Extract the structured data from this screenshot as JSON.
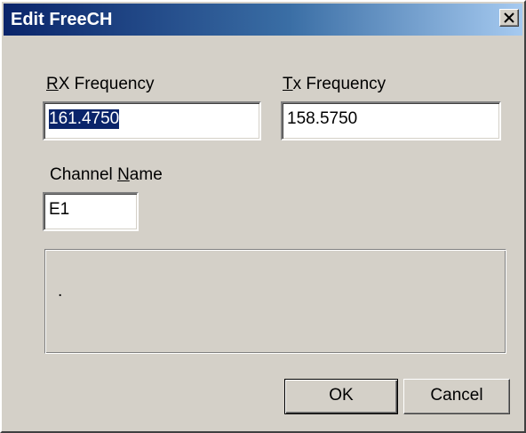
{
  "window": {
    "title": "Edit FreeCH",
    "close_icon": "close-icon"
  },
  "rx": {
    "label_mnemonic": "R",
    "label_rest": "X Frequency",
    "value": "161.4750"
  },
  "tx": {
    "label_mnemonic": "T",
    "label_rest": "x Frequency",
    "value": "158.5750"
  },
  "channel": {
    "label_pre": "Channel ",
    "label_mnemonic": "N",
    "label_rest": "ame",
    "value": "E1"
  },
  "message": {
    "text": "."
  },
  "buttons": {
    "ok": "OK",
    "cancel": "Cancel"
  },
  "colors": {
    "dialog_face": "#d4d0c8",
    "titlebar_start": "#0a246a",
    "titlebar_end": "#a6caf0",
    "selection": "#0a246a"
  }
}
